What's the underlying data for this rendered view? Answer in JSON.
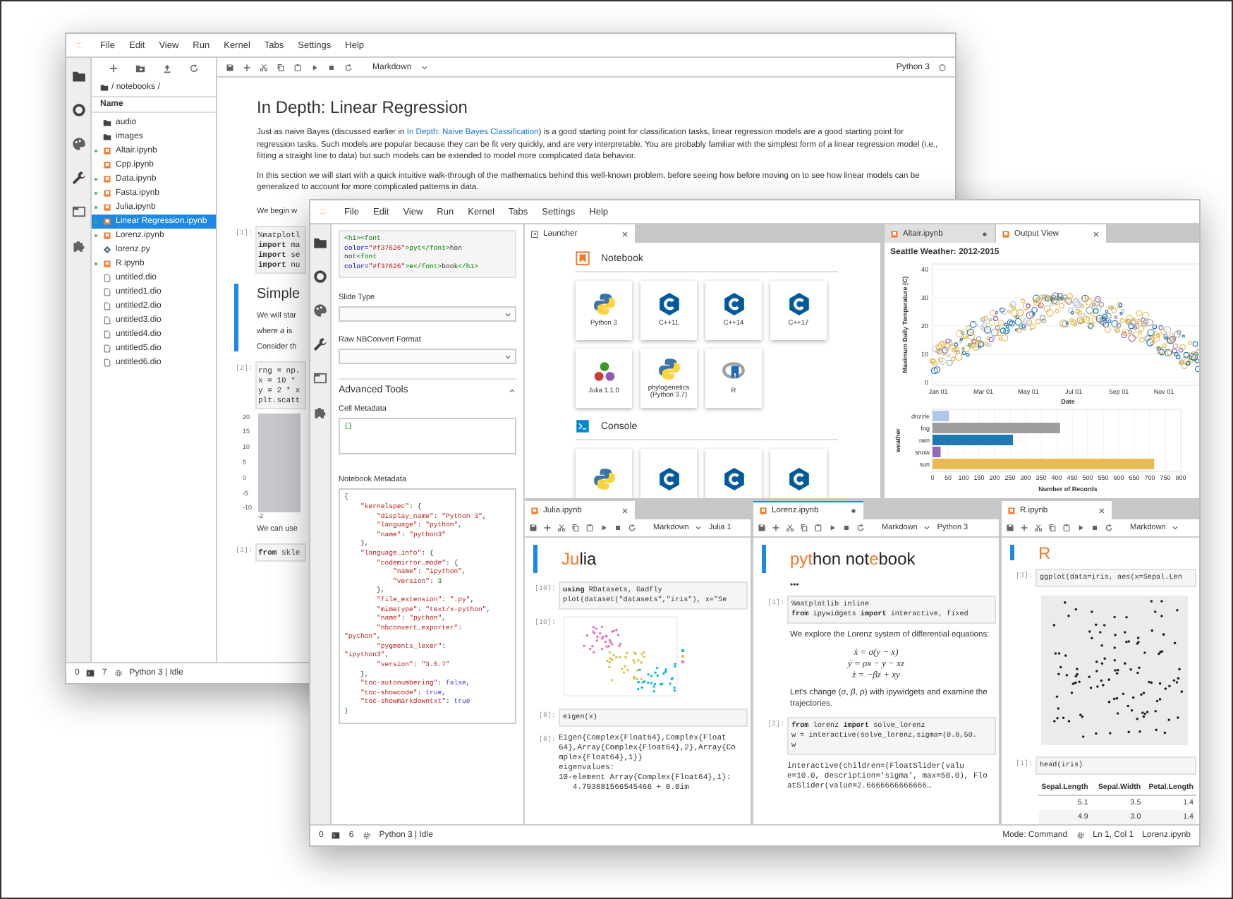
{
  "back_window": {
    "menu": [
      "File",
      "Edit",
      "View",
      "Run",
      "Kernel",
      "Tabs",
      "Settings",
      "Help"
    ],
    "file_browser": {
      "path": "/ notebooks /",
      "column": "Name",
      "items": [
        {
          "name": "audio",
          "kind": "folder",
          "running": false,
          "selected": false
        },
        {
          "name": "images",
          "kind": "folder",
          "running": false,
          "selected": false
        },
        {
          "name": "Altair.ipynb",
          "kind": "notebook",
          "running": true,
          "selected": false
        },
        {
          "name": "Cpp.ipynb",
          "kind": "notebook",
          "running": false,
          "selected": false
        },
        {
          "name": "Data.ipynb",
          "kind": "notebook",
          "running": true,
          "selected": false
        },
        {
          "name": "Fasta.ipynb",
          "kind": "notebook",
          "running": true,
          "selected": false
        },
        {
          "name": "Julia.ipynb",
          "kind": "notebook",
          "running": true,
          "selected": false
        },
        {
          "name": "Linear Regression.ipynb",
          "kind": "notebook",
          "running": true,
          "selected": true
        },
        {
          "name": "Lorenz.ipynb",
          "kind": "notebook",
          "running": true,
          "selected": false
        },
        {
          "name": "lorenz.py",
          "kind": "python",
          "running": false,
          "selected": false
        },
        {
          "name": "R.ipynb",
          "kind": "notebook",
          "running": true,
          "selected": false
        },
        {
          "name": "untitled.dio",
          "kind": "file",
          "running": false,
          "selected": false
        },
        {
          "name": "untitled1.dio",
          "kind": "file",
          "running": false,
          "selected": false
        },
        {
          "name": "untitled2.dio",
          "kind": "file",
          "running": false,
          "selected": false
        },
        {
          "name": "untitled3.dio",
          "kind": "file",
          "running": false,
          "selected": false
        },
        {
          "name": "untitled4.dio",
          "kind": "file",
          "running": false,
          "selected": false
        },
        {
          "name": "untitled5.dio",
          "kind": "file",
          "running": false,
          "selected": false
        },
        {
          "name": "untitled6.dio",
          "kind": "file",
          "running": false,
          "selected": false
        }
      ]
    },
    "toolbar": {
      "cell_type": "Markdown",
      "kernel": "Python 3"
    },
    "notebook": {
      "title": "In Depth: Linear Regression",
      "intro": {
        "before": "Just as naive Bayes (discussed earlier in ",
        "link": "In Depth: Naive Bayes Classification",
        "after": ") is a good starting point for classification tasks, linear regression models are a good starting point for regression tasks. Such models are popular because they can be fit very quickly, and are very interpretable. You are probably familiar with the simplest form of a linear regression model (i.e., fitting a straight line to data) but such models can be extended to model more complicated data behavior."
      },
      "paragraph": "In this section we will start with a quick intuitive walk-through of the mathematics behind this well-known problem, before seeing how before moving on to see how linear models can be generalized to account for more complicated patterns in data.",
      "cells": [
        {
          "kind": "markdown",
          "active": false,
          "lines": [
            "We begin w"
          ]
        },
        {
          "kind": "code",
          "prompt": "[1]:",
          "lines": [
            "%matplotl",
            "**import** ma",
            "**import** se",
            "**import** nu"
          ]
        },
        {
          "kind": "markdown",
          "active": true,
          "heading": "Simple",
          "lines": [
            "We will star",
            "where *a* is",
            "Consider th"
          ]
        },
        {
          "kind": "code",
          "prompt": "[2]:",
          "lines": [
            "rng = np.",
            "x = 10 *",
            "y = 2 * x",
            "plt.scatt"
          ]
        },
        {
          "kind": "plot",
          "yticks": [
            "20",
            "15",
            "10",
            "5",
            "0",
            "-5",
            "-10"
          ],
          "xticks": [
            "-2"
          ]
        },
        {
          "kind": "markdown",
          "active": false,
          "lines": [
            "We can use"
          ]
        },
        {
          "kind": "code",
          "prompt": "[3]:",
          "lines": [
            "**from** skle"
          ]
        }
      ]
    },
    "status": {
      "terminals": "0",
      "kernels": "7",
      "kernel": "Python 3 | Idle"
    }
  },
  "front_window": {
    "menu": [
      "File",
      "Edit",
      "View",
      "Run",
      "Kernel",
      "Tabs",
      "Settings",
      "Help"
    ],
    "inspector": {
      "source": [
        [
          {
            "text": "<h1><font",
            "kind": "tag"
          }
        ],
        [
          {
            "text": "color=",
            "kind": "attr"
          },
          {
            "text": "\"#f37626\"",
            "kind": "string"
          },
          {
            "text": ">pyt</font>",
            "kind": "tag"
          },
          {
            "text": "hon",
            "kind": "plain"
          }
        ],
        [
          {
            "text": "not",
            "kind": "plain"
          },
          {
            "text": "<font",
            "kind": "tag"
          }
        ],
        [
          {
            "text": "color=",
            "kind": "attr"
          },
          {
            "text": "\"#f37626\"",
            "kind": "string"
          },
          {
            "text": ">e</font>",
            "kind": "tag"
          },
          {
            "text": "book",
            "kind": "plain"
          },
          {
            "text": "</h1>",
            "kind": "tag"
          }
        ]
      ],
      "slide_type": "Slide Type",
      "raw_format": "Raw NBConvert Format",
      "advanced": "Advanced Tools",
      "advanced_expanded": true,
      "cell_metadata_label": "Cell Metadata",
      "cell_metadata": [
        [
          {
            "text": "{}",
            "kind": "brace"
          }
        ]
      ],
      "notebook_metadata_label": "Notebook Metadata",
      "notebook_metadata": [
        [
          {
            "text": "{",
            "kind": "brace"
          }
        ],
        [
          {
            "text": "    \"kernelspec\"",
            "kind": "string"
          },
          {
            "text": ": {",
            "kind": "plain"
          }
        ],
        [
          {
            "text": "        \"display_name\"",
            "kind": "string"
          },
          {
            "text": ": ",
            "kind": "plain"
          },
          {
            "text": "\"Python 3\"",
            "kind": "string"
          },
          {
            "text": ",",
            "kind": "plain"
          }
        ],
        [
          {
            "text": "        \"language\"",
            "kind": "string"
          },
          {
            "text": ": ",
            "kind": "plain"
          },
          {
            "text": "\"python\"",
            "kind": "string"
          },
          {
            "text": ",",
            "kind": "plain"
          }
        ],
        [
          {
            "text": "        \"name\"",
            "kind": "string"
          },
          {
            "text": ": ",
            "kind": "plain"
          },
          {
            "text": "\"python3\"",
            "kind": "string"
          }
        ],
        [
          {
            "text": "    },",
            "kind": "plain"
          }
        ],
        [
          {
            "text": "    \"language_info\"",
            "kind": "string"
          },
          {
            "text": ": {",
            "kind": "plain"
          }
        ],
        [
          {
            "text": "        \"codemirror_mode\"",
            "kind": "string"
          },
          {
            "text": ": {",
            "kind": "plain"
          }
        ],
        [
          {
            "text": "            \"name\"",
            "kind": "string"
          },
          {
            "text": ": ",
            "kind": "plain"
          },
          {
            "text": "\"ipython\"",
            "kind": "string"
          },
          {
            "text": ",",
            "kind": "plain"
          }
        ],
        [
          {
            "text": "            \"version\"",
            "kind": "string"
          },
          {
            "text": ": ",
            "kind": "plain"
          },
          {
            "text": "3",
            "kind": "number"
          }
        ],
        [
          {
            "text": "        },",
            "kind": "plain"
          }
        ],
        [
          {
            "text": "        \"file_extension\"",
            "kind": "string"
          },
          {
            "text": ": ",
            "kind": "plain"
          },
          {
            "text": "\".py\"",
            "kind": "string"
          },
          {
            "text": ",",
            "kind": "plain"
          }
        ],
        [
          {
            "text": "        \"mimetype\"",
            "kind": "string"
          },
          {
            "text": ": ",
            "kind": "plain"
          },
          {
            "text": "\"text/x-python\"",
            "kind": "string"
          },
          {
            "text": ",",
            "kind": "plain"
          }
        ],
        [
          {
            "text": "        \"name\"",
            "kind": "string"
          },
          {
            "text": ": ",
            "kind": "plain"
          },
          {
            "text": "\"python\"",
            "kind": "string"
          },
          {
            "text": ",",
            "kind": "plain"
          }
        ],
        [
          {
            "text": "        \"nbconvert_exporter\"",
            "kind": "string"
          },
          {
            "text": ":",
            "kind": "plain"
          }
        ],
        [
          {
            "text": "\"python\"",
            "kind": "string"
          },
          {
            "text": ",",
            "kind": "plain"
          }
        ],
        [
          {
            "text": "        \"pygments_lexer\"",
            "kind": "string"
          },
          {
            "text": ":",
            "kind": "plain"
          }
        ],
        [
          {
            "text": "\"ipython3\"",
            "kind": "string"
          },
          {
            "text": ",",
            "kind": "plain"
          }
        ],
        [
          {
            "text": "        \"version\"",
            "kind": "string"
          },
          {
            "text": ": ",
            "kind": "plain"
          },
          {
            "text": "\"3.6.7\"",
            "kind": "string"
          }
        ],
        [
          {
            "text": "    },",
            "kind": "plain"
          }
        ],
        [
          {
            "text": "    \"toc-autonumbering\"",
            "kind": "string"
          },
          {
            "text": ": ",
            "kind": "plain"
          },
          {
            "text": "false",
            "kind": "bool"
          },
          {
            "text": ",",
            "kind": "plain"
          }
        ],
        [
          {
            "text": "    \"toc-showcode\"",
            "kind": "string"
          },
          {
            "text": ": ",
            "kind": "plain"
          },
          {
            "text": "true",
            "kind": "bool"
          },
          {
            "text": ",",
            "kind": "plain"
          }
        ],
        [
          {
            "text": "    \"toc-showmarkdowntxt\"",
            "kind": "string"
          },
          {
            "text": ": ",
            "kind": "plain"
          },
          {
            "text": "true",
            "kind": "bool"
          }
        ],
        [
          {
            "text": "}",
            "kind": "brace"
          }
        ]
      ]
    },
    "launcher": {
      "tab": {
        "label": "Launcher",
        "selected": true
      },
      "sections": [
        {
          "title": "Notebook",
          "kind": "notebook",
          "items": [
            {
              "label": "Python 3",
              "kind": "python"
            },
            {
              "label": "C++11",
              "kind": "cpp"
            },
            {
              "label": "C++14",
              "kind": "cpp"
            },
            {
              "label": "C++17",
              "kind": "cpp"
            },
            {
              "label": "Julia 1.1.0",
              "kind": "julia"
            },
            {
              "label": "phylogenetics (Python 3.7)",
              "kind": "python"
            },
            {
              "label": "R",
              "kind": "r"
            }
          ]
        },
        {
          "title": "Console",
          "kind": "console",
          "items": [
            {
              "kind": "python"
            },
            {
              "kind": "cpp"
            },
            {
              "kind": "cpp"
            },
            {
              "kind": "cpp"
            }
          ]
        }
      ]
    },
    "output": {
      "tabs": [
        {
          "label": "Altair.ipynb",
          "modified": true,
          "selected": false
        },
        {
          "label": "Output View",
          "modified": false,
          "selected": true
        }
      ],
      "title": "Seattle Weather: 2012-2015",
      "temperature_plot": {
        "ylabel": "Maximum Daily Temperature (C)",
        "yticks": [
          "40",
          "30",
          "20",
          "10",
          "0"
        ],
        "xlabel": "Date",
        "xticks": [
          "Jan 01",
          "Mar 01",
          "May 01",
          "Jul 01",
          "Sep 01",
          "Nov 01"
        ]
      },
      "chart_data": {
        "type": "bar",
        "orientation": "horizontal",
        "grid": true,
        "xlabel": "Number of Records",
        "ylabel": "weather",
        "categories": [
          "drizzle",
          "fog",
          "rain",
          "snow",
          "sun"
        ],
        "values": [
          53,
          411,
          259,
          26,
          714
        ],
        "colors": [
          "#aec7e8",
          "#9e9e9e",
          "#1f77b4",
          "#9467bd",
          "#e7ba52"
        ],
        "xlim": [
          0,
          800
        ],
        "xticks": [
          0,
          50,
          100,
          150,
          200,
          250,
          300,
          350,
          400,
          450,
          500,
          550,
          600,
          650,
          700,
          750,
          800
        ]
      }
    },
    "notebooks": [
      {
        "tab": {
          "label": "Julia.ipynb",
          "modified": false,
          "focused": false
        },
        "cell_type": "Markdown",
        "kernel": "Julia 1",
        "heading": [
          {
            "text": "Ju",
            "accent": true
          },
          {
            "text": "lia",
            "accent": false
          }
        ],
        "cells": [
          {
            "kind": "code",
            "prompt": "[10]:",
            "lines": [
              "**using** RDatasets, Gadfly",
              "plot(dataset(\"datasets\",\"iris\"), x=\"Se"
            ]
          },
          {
            "kind": "iris_plot",
            "prompt": "[10]:"
          },
          {
            "kind": "code",
            "prompt": "[8]:",
            "lines": [
              "eigen(x)"
            ]
          },
          {
            "kind": "output",
            "prompt": "[8]:",
            "lines": [
              "Eigen{Complex{Float64},Complex{Float",
              "64},Array{Complex{Float64},2},Array{Co",
              "mplex{Float64},1}}",
              "eigenvalues:",
              "10-element Array{Complex{Float64},1}:",
              "   4.793881566545466 + 0.0im"
            ]
          }
        ]
      },
      {
        "tab": {
          "label": "Lorenz.ipynb",
          "modified": true,
          "focused": true
        },
        "cell_type": "Markdown",
        "kernel": "Python 3",
        "heading": [
          {
            "text": "pyt",
            "accent": true
          },
          {
            "text": "hon not",
            "accent": false
          },
          {
            "text": "e",
            "accent": true
          },
          {
            "text": "book",
            "accent": false
          }
        ],
        "cells": [
          {
            "kind": "collapsed",
            "text": "•••"
          },
          {
            "kind": "code",
            "prompt": "[1]:",
            "lines": [
              "%matplotlib inline",
              "**from** ipywidgets **import** interactive, fixed"
            ]
          },
          {
            "kind": "text",
            "text": "We explore the Lorenz system of differential equations:"
          },
          {
            "kind": "equations",
            "lines": [
              "ẋ = σ(y − x)",
              "ẏ = ρx − y − xz",
              "ż = −βz + xy"
            ]
          },
          {
            "kind": "text",
            "text": "Let's change (*σ*, *β*, *ρ*) with ipywidgets and examine the trajectories."
          },
          {
            "kind": "code",
            "prompt": "[2]:",
            "lines": [
              "**from** lorenz **import** solve_lorenz",
              "w = interactive(solve_lorenz,sigma=(0.0,50.",
              "w"
            ]
          },
          {
            "kind": "output",
            "lines": [
              "interactive(children=(FloatSlider(valu",
              "e=10.0, description='sigma', max=50.0), Flo",
              "atSlider(value=2.6666666666666…"
            ]
          }
        ]
      },
      {
        "tab": {
          "label": "R.ipynb",
          "modified": false,
          "focused": false
        },
        "cell_type": "Markdown",
        "heading": [
          {
            "text": "R",
            "accent": true
          }
        ],
        "cells": [
          {
            "kind": "code",
            "prompt": "[3]:",
            "lines": [
              "ggplot(data=iris, aes(x=Sepal.Len"
            ]
          },
          {
            "kind": "ggplot_plot"
          },
          {
            "kind": "code",
            "prompt": "[1]:",
            "lines": [
              "head(iris)"
            ]
          },
          {
            "kind": "table",
            "columns": [
              "Sepal.Length",
              "Sepal.Width",
              "Petal.Length"
            ],
            "rows": [
              [
                "5.1",
                "3.5",
                "1.4"
              ],
              [
                "4.9",
                "3.0",
                "1.4"
              ]
            ]
          }
        ]
      }
    ],
    "status": {
      "terminals": "0",
      "kernels": "6",
      "kernel": "Python 3 | Idle",
      "mode": "Mode: Command",
      "position": "Ln 1, Col 1",
      "file": "Lorenz.ipynb"
    }
  }
}
